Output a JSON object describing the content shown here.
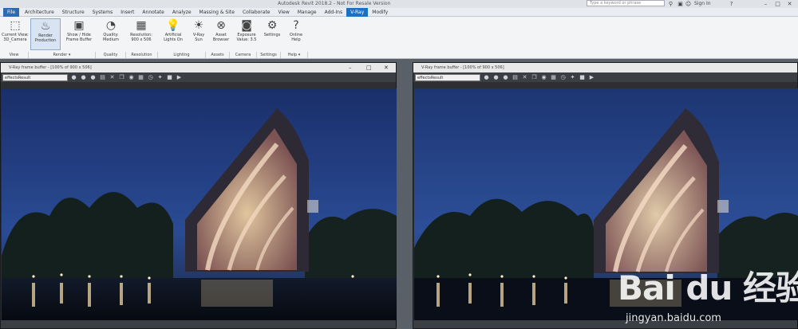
{
  "window": {
    "title": "Autodesk Revit 2018.2 - Not For Resale Version",
    "search_placeholder": "Type a keyword or phrase",
    "sign_in": "Sign In"
  },
  "tabs": [
    {
      "label": "File"
    },
    {
      "label": "Architecture"
    },
    {
      "label": "Structure"
    },
    {
      "label": "Systems"
    },
    {
      "label": "Insert"
    },
    {
      "label": "Annotate"
    },
    {
      "label": "Analyze"
    },
    {
      "label": "Massing & Site"
    },
    {
      "label": "Collaborate"
    },
    {
      "label": "View"
    },
    {
      "label": "Manage"
    },
    {
      "label": "Add-Ins"
    },
    {
      "label": "V-Ray"
    },
    {
      "label": "Modify"
    }
  ],
  "ribbon": {
    "buttons": [
      {
        "label1": "Current View:",
        "label2": "3D_Camera",
        "icon": "view-icon"
      },
      {
        "label1": "Render",
        "label2": "Production",
        "icon": "teapot-icon"
      },
      {
        "label1": "Show / Hide",
        "label2": "Frame Buffer",
        "icon": "framebuffer-icon"
      },
      {
        "label1": "Quality:",
        "label2": "Medium",
        "icon": "quality-icon"
      },
      {
        "label1": "Resolution:",
        "label2": "900 x 506",
        "icon": "resolution-icon"
      },
      {
        "label1": "Artificial",
        "label2": "Lights On",
        "icon": "bulb-icon"
      },
      {
        "label1": "V-Ray",
        "label2": "Sun",
        "icon": "sun-icon"
      },
      {
        "label1": "Asset",
        "label2": "Browser",
        "icon": "asset-icon"
      },
      {
        "label1": "Exposure",
        "label2": "Value: 3.5",
        "icon": "camera-icon"
      },
      {
        "label1": "Settings",
        "label2": "",
        "icon": "gear-icon"
      },
      {
        "label1": "Online",
        "label2": "Help",
        "icon": "help-icon"
      }
    ],
    "groups": [
      {
        "label": "View"
      },
      {
        "label": "Render ▾"
      },
      {
        "label": "Quality"
      },
      {
        "label": "Resolution"
      },
      {
        "label": "Lighting"
      },
      {
        "label": "Assets"
      },
      {
        "label": "Camera"
      },
      {
        "label": "Settings"
      },
      {
        "label": "Help ▾"
      }
    ]
  },
  "vfb_left": {
    "title": "V-Ray frame buffer - [100% of 900 x 506]",
    "channel": "effectsResult"
  },
  "vfb_right": {
    "title": "V-Ray frame buffer - [100% of 900 x 506]",
    "channel": "effectsResult"
  },
  "watermark": {
    "logo": "Bai du 经验",
    "url": "jingyan.baidu.com"
  },
  "colors": {
    "active_tab": "#1f6fc3",
    "sky": "#23428a",
    "ribbon": "#f3f4f6"
  }
}
